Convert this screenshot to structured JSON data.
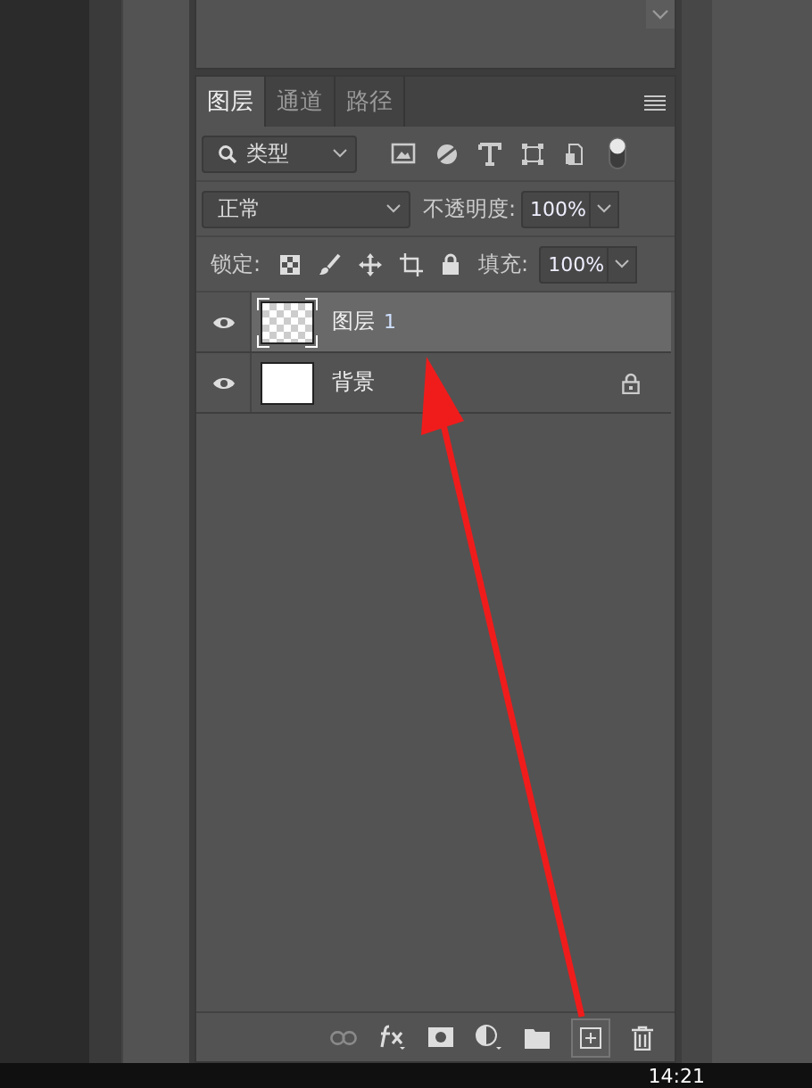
{
  "tabs": [
    {
      "label": "图层",
      "selected": true
    },
    {
      "label": "通道",
      "selected": false
    },
    {
      "label": "路径",
      "selected": false
    }
  ],
  "filter": {
    "value": "类型",
    "on": true
  },
  "blend": {
    "value": "正常"
  },
  "opacity": {
    "label": "不透明度:",
    "value": "100%"
  },
  "lock": {
    "label": "锁定:"
  },
  "fill": {
    "label": "填充:",
    "value": "100%"
  },
  "layers": [
    {
      "name": "图层",
      "suffix": "1",
      "visible": true,
      "selected": true,
      "locked": false,
      "transparent": true
    },
    {
      "name": "背景",
      "visible": true,
      "selected": false,
      "locked": true,
      "transparent": false
    }
  ],
  "taskbar": {
    "time": "14:21"
  }
}
